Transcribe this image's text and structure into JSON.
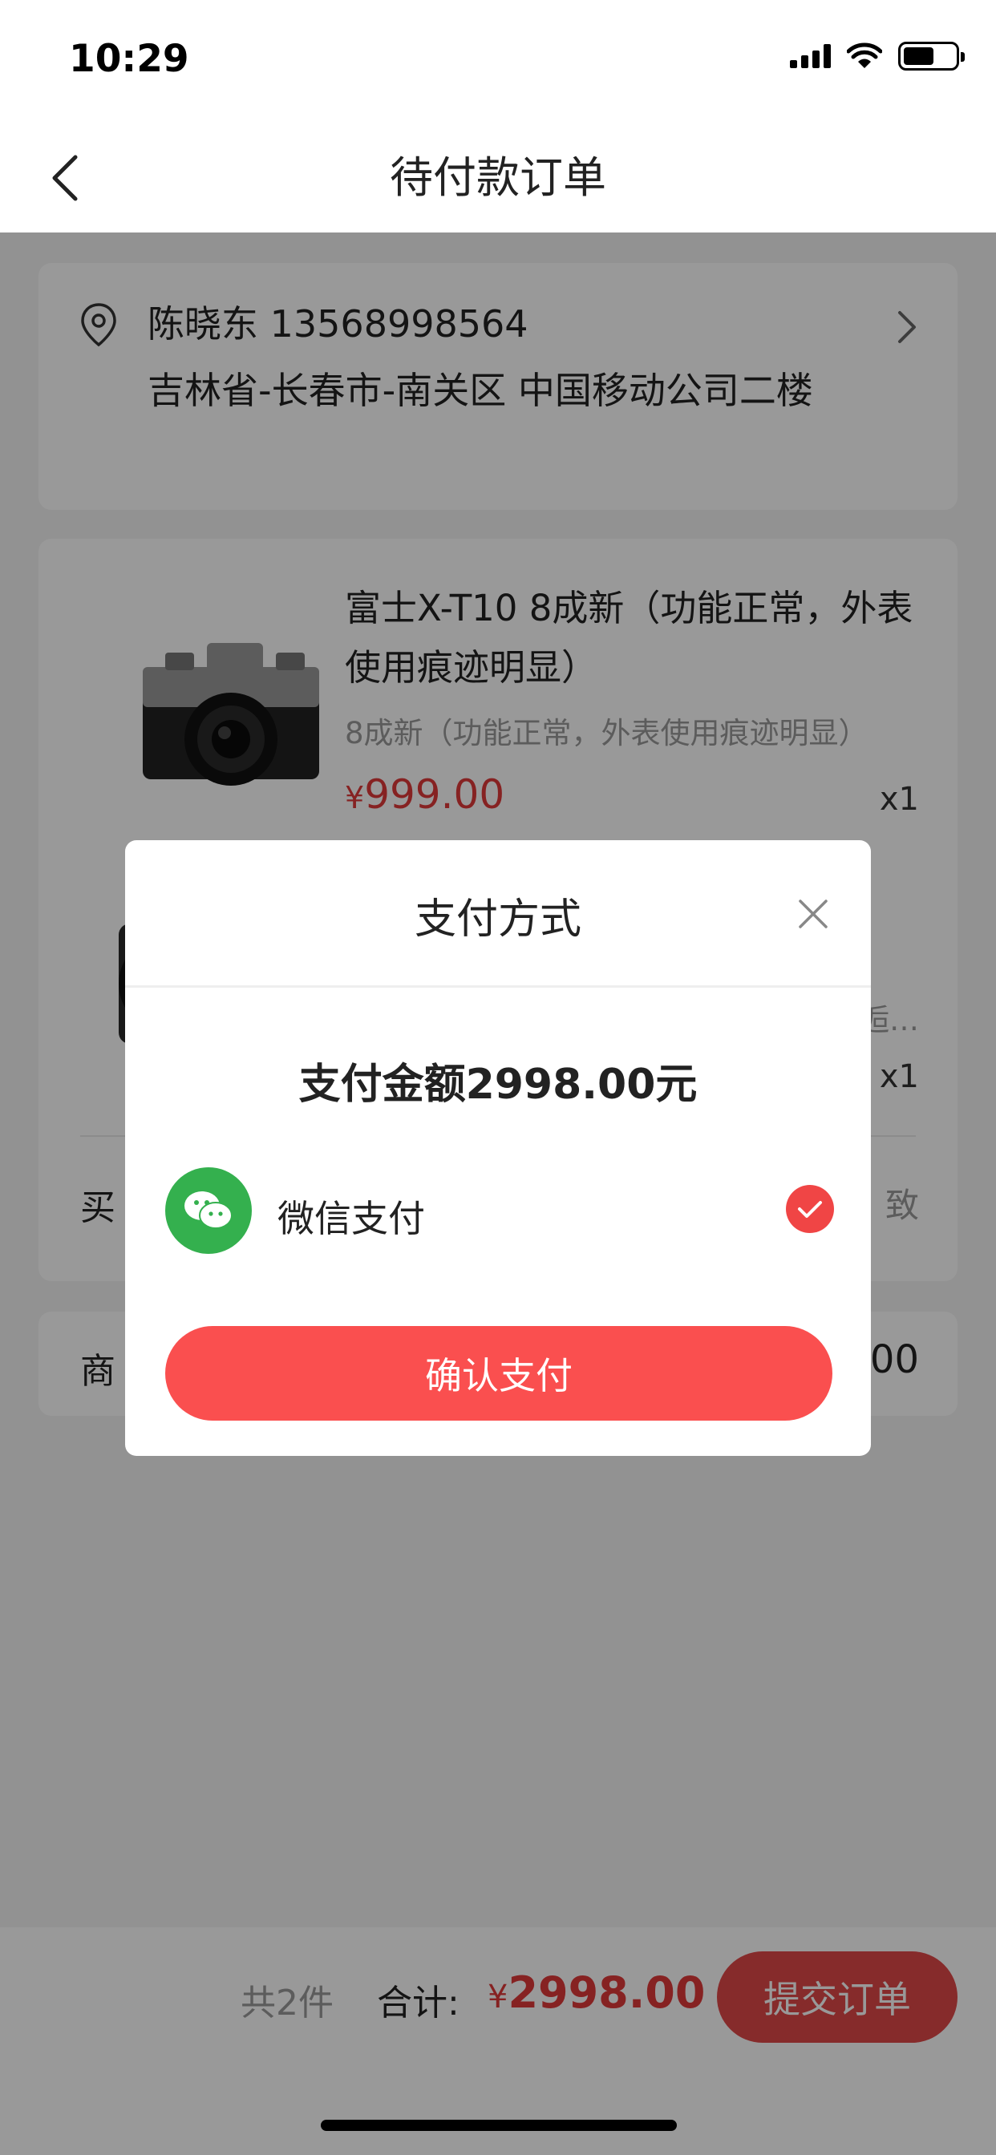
{
  "status_bar": {
    "time": "10:29"
  },
  "nav": {
    "title": "待付款订单"
  },
  "address": {
    "name_phone": "陈晓东 13568998564",
    "detail": "吉林省-长春市-南关区 中国移动公司二楼"
  },
  "goods": [
    {
      "title": "富士X-T10 8成新（功能正常，外表使用痕迹明显）",
      "spec": "8成新（功能正常，外表使用痕迹明显）",
      "currency": "¥",
      "price": "999.00",
      "qty": "x1"
    },
    {
      "spec_fragment": "逅…",
      "qty": "x1"
    }
  ],
  "remark": {
    "label_fragment": "买",
    "value_fragment": "致"
  },
  "amount_row": {
    "label_fragment": "商",
    "value_fragment": "00"
  },
  "bottom_bar": {
    "count": "共2件",
    "total_label": "合计:",
    "currency": "¥",
    "total_value": "2998.00",
    "submit_label": "提交订单"
  },
  "modal": {
    "title": "支付方式",
    "amount_text": "支付金额2998.00元",
    "option_label": "微信支付",
    "confirm_label": "确认支付"
  },
  "colors": {
    "accent_red": "#fa4f4f",
    "price_red": "#e0393a",
    "wechat_green": "#34b04e"
  }
}
